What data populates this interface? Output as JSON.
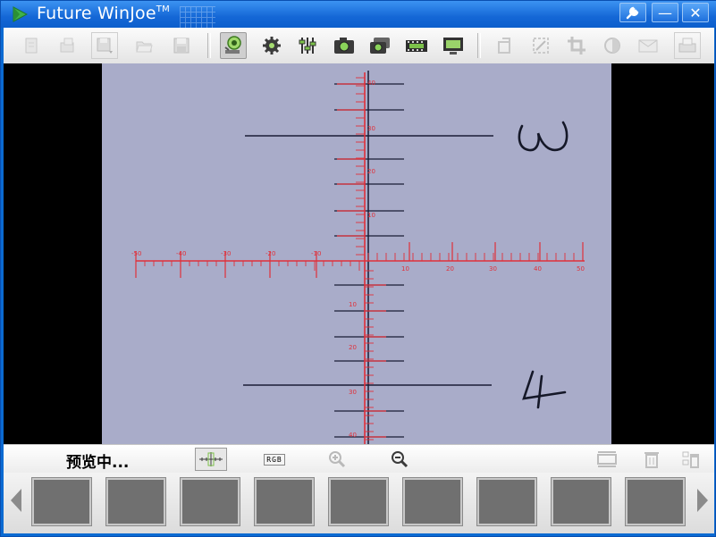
{
  "window": {
    "title": "Future WinJoe",
    "trademark": "TM",
    "settings_icon": "wrench-icon",
    "minimize_label": "—",
    "close_label": "✕"
  },
  "toolbar": {
    "icons": [
      "new-icon",
      "open-folder-icon",
      "save-dropdown-icon",
      "folder-icon",
      "save-icon",
      "camera-preview-icon",
      "settings-gear-icon",
      "adjust-sliders-icon",
      "capture-photo-icon",
      "capture-burst-icon",
      "record-video-icon",
      "display-icon",
      "rotate-icon",
      "resize-icon",
      "crop-icon",
      "contrast-icon",
      "email-icon",
      "print-icon"
    ]
  },
  "preview": {
    "reticle_labels_h": [
      "-50",
      "-40",
      "-30",
      "-20",
      "-10",
      "10",
      "20",
      "30",
      "40",
      "50"
    ],
    "reticle_labels_v": [
      "40",
      "30",
      "20",
      "10",
      "10",
      "20",
      "30",
      "40"
    ],
    "handwritten": [
      "3",
      "4"
    ]
  },
  "status": {
    "text": "预览中...",
    "tools": [
      "reticle-icon",
      "rgb-icon",
      "zoom-in-icon",
      "zoom-out-icon",
      "fit-window-icon",
      "trash-icon",
      "batch-delete-icon"
    ],
    "rgb_label": "RGB"
  },
  "thumbnails": {
    "count": 9
  },
  "colors": {
    "window_blue": "#0a6ad2",
    "reticle_red": "#e0303a",
    "paper": "#a9acc9"
  }
}
